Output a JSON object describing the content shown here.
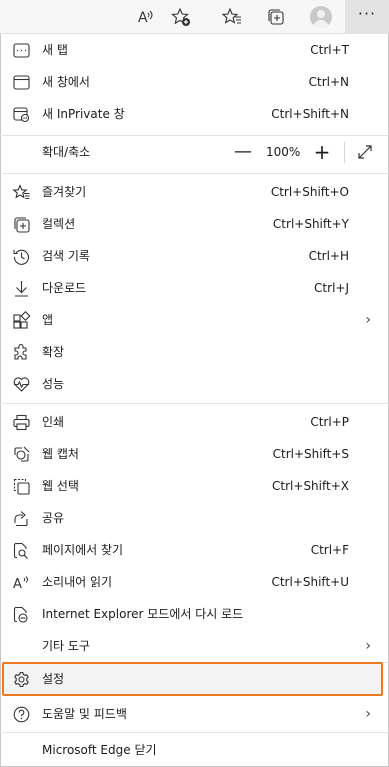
{
  "toolbar": {
    "icons": [
      "read-aloud-icon",
      "add-favorite-icon",
      "favorites-icon",
      "collections-icon",
      "profile-avatar",
      "more-icon"
    ],
    "read_aloud_glyph": "A",
    "more_glyph": "···"
  },
  "menu": {
    "new_tab": {
      "label": "새 탭",
      "shortcut": "Ctrl+T"
    },
    "new_window": {
      "label": "새 창에서",
      "shortcut": "Ctrl+N"
    },
    "new_inprivate": {
      "label": "새 InPrivate 창",
      "shortcut": "Ctrl+Shift+N"
    },
    "zoom": {
      "label": "확대/축소",
      "minus": "—",
      "value": "100%",
      "plus": "+"
    },
    "favorites": {
      "label": "즐겨찾기",
      "shortcut": "Ctrl+Shift+O"
    },
    "collections": {
      "label": "컬렉션",
      "shortcut": "Ctrl+Shift+Y"
    },
    "history": {
      "label": "검색 기록",
      "shortcut": "Ctrl+H"
    },
    "downloads": {
      "label": "다운로드",
      "shortcut": "Ctrl+J"
    },
    "apps": {
      "label": "앱",
      "chevron": "›"
    },
    "extensions": {
      "label": "확장"
    },
    "performance": {
      "label": "성능"
    },
    "print": {
      "label": "인쇄",
      "shortcut": "Ctrl+P"
    },
    "web_capture": {
      "label": "웹 캡처",
      "shortcut": "Ctrl+Shift+S"
    },
    "web_select": {
      "label": "웹 선택",
      "shortcut": "Ctrl+Shift+X"
    },
    "share": {
      "label": "공유"
    },
    "find": {
      "label": "페이지에서 찾기",
      "shortcut": "Ctrl+F"
    },
    "read_aloud": {
      "label": "소리내어 읽기",
      "shortcut": "Ctrl+Shift+U"
    },
    "ie_mode": {
      "label": "Internet Explorer 모드에서 다시 로드"
    },
    "more_tools": {
      "label": "기타 도구",
      "chevron": "›"
    },
    "settings": {
      "label": "설정"
    },
    "help": {
      "label": "도움말 및 피드백",
      "chevron": "›"
    },
    "close": {
      "label": "Microsoft Edge 닫기"
    }
  },
  "colors": {
    "highlight_border": "#ea7a22",
    "toolbar_bg": "#f7f7f7"
  }
}
